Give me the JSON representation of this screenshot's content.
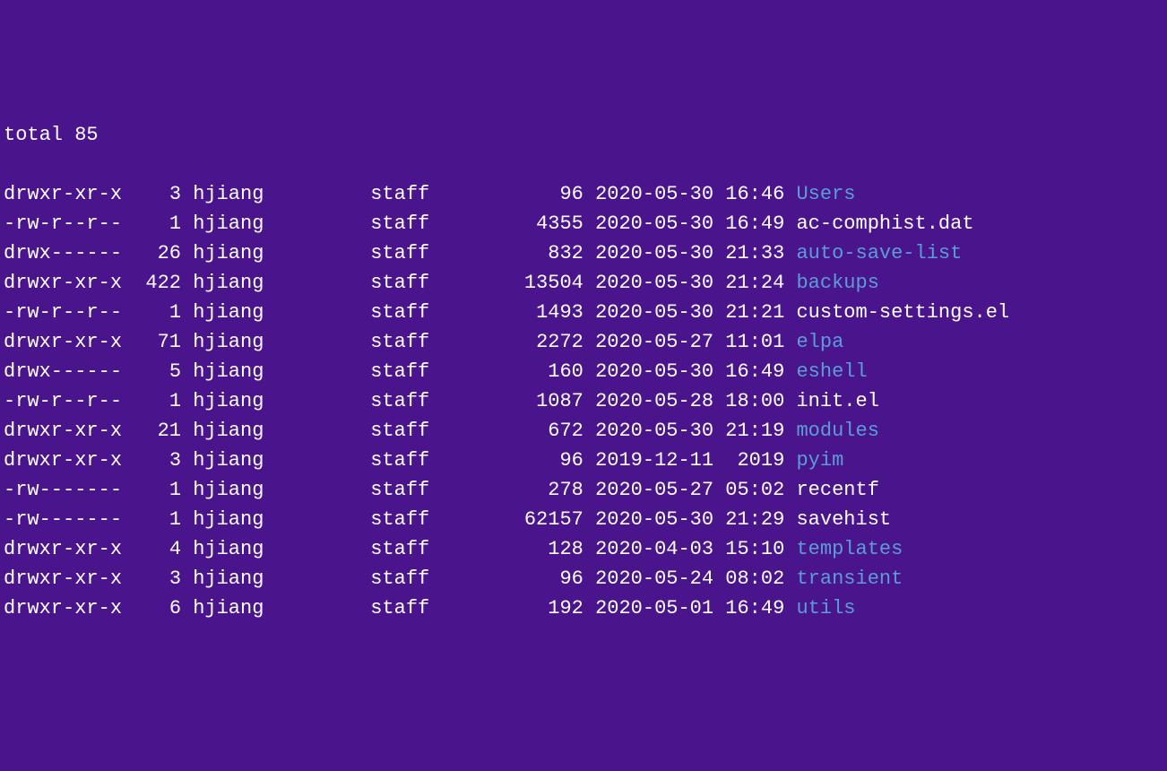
{
  "total_line": "total 85",
  "entries": [
    {
      "perms": "drwxr-xr-x",
      "links": "3",
      "user": "hjiang",
      "group": "staff",
      "size": "96",
      "date": "2020-05-30",
      "time": "16:46",
      "name": "Users",
      "type": "dir"
    },
    {
      "perms": "-rw-r--r--",
      "links": "1",
      "user": "hjiang",
      "group": "staff",
      "size": "4355",
      "date": "2020-05-30",
      "time": "16:49",
      "name": "ac-comphist.dat",
      "type": "file"
    },
    {
      "perms": "drwx------",
      "links": "26",
      "user": "hjiang",
      "group": "staff",
      "size": "832",
      "date": "2020-05-30",
      "time": "21:33",
      "name": "auto-save-list",
      "type": "dir"
    },
    {
      "perms": "drwxr-xr-x",
      "links": "422",
      "user": "hjiang",
      "group": "staff",
      "size": "13504",
      "date": "2020-05-30",
      "time": "21:24",
      "name": "backups",
      "type": "dir"
    },
    {
      "perms": "-rw-r--r--",
      "links": "1",
      "user": "hjiang",
      "group": "staff",
      "size": "1493",
      "date": "2020-05-30",
      "time": "21:21",
      "name": "custom-settings.el",
      "type": "file"
    },
    {
      "perms": "drwxr-xr-x",
      "links": "71",
      "user": "hjiang",
      "group": "staff",
      "size": "2272",
      "date": "2020-05-27",
      "time": "11:01",
      "name": "elpa",
      "type": "dir"
    },
    {
      "perms": "drwx------",
      "links": "5",
      "user": "hjiang",
      "group": "staff",
      "size": "160",
      "date": "2020-05-30",
      "time": "16:49",
      "name": "eshell",
      "type": "dir"
    },
    {
      "perms": "-rw-r--r--",
      "links": "1",
      "user": "hjiang",
      "group": "staff",
      "size": "1087",
      "date": "2020-05-28",
      "time": "18:00",
      "name": "init.el",
      "type": "file"
    },
    {
      "perms": "drwxr-xr-x",
      "links": "21",
      "user": "hjiang",
      "group": "staff",
      "size": "672",
      "date": "2020-05-30",
      "time": "21:19",
      "name": "modules",
      "type": "dir"
    },
    {
      "perms": "drwxr-xr-x",
      "links": "3",
      "user": "hjiang",
      "group": "staff",
      "size": "96",
      "date": "2019-12-11",
      "time": "2019",
      "name": "pyim",
      "type": "dir"
    },
    {
      "perms": "-rw-------",
      "links": "1",
      "user": "hjiang",
      "group": "staff",
      "size": "278",
      "date": "2020-05-27",
      "time": "05:02",
      "name": "recentf",
      "type": "file"
    },
    {
      "perms": "-rw-------",
      "links": "1",
      "user": "hjiang",
      "group": "staff",
      "size": "62157",
      "date": "2020-05-30",
      "time": "21:29",
      "name": "savehist",
      "type": "file"
    },
    {
      "perms": "drwxr-xr-x",
      "links": "4",
      "user": "hjiang",
      "group": "staff",
      "size": "128",
      "date": "2020-04-03",
      "time": "15:10",
      "name": "templates",
      "type": "dir"
    },
    {
      "perms": "drwxr-xr-x",
      "links": "3",
      "user": "hjiang",
      "group": "staff",
      "size": "96",
      "date": "2020-05-24",
      "time": "08:02",
      "name": "transient",
      "type": "dir"
    },
    {
      "perms": "drwxr-xr-x",
      "links": "6",
      "user": "hjiang",
      "group": "staff",
      "size": "192",
      "date": "2020-05-01",
      "time": "16:49",
      "name": "utils",
      "type": "dir"
    }
  ]
}
